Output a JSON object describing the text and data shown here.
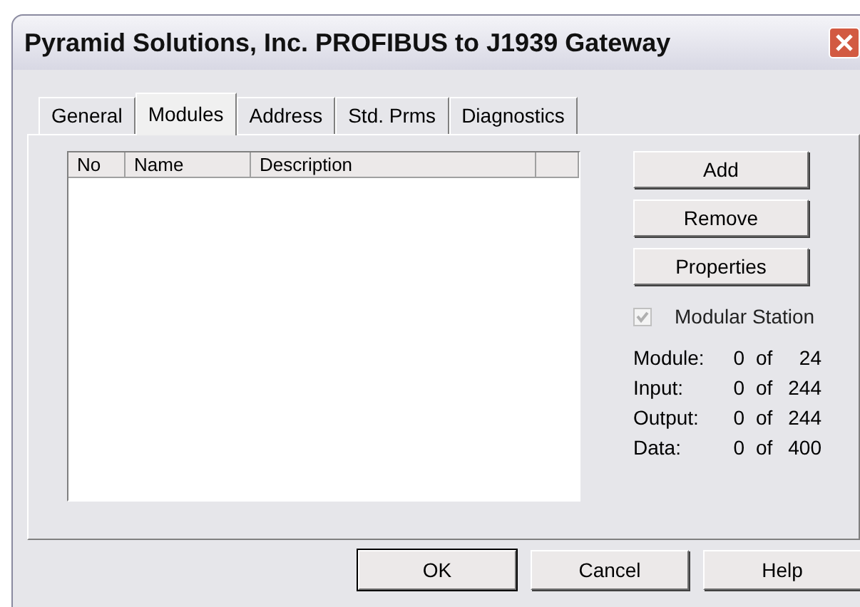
{
  "window": {
    "title": "Pyramid Solutions, Inc. PROFIBUS to J1939 Gateway"
  },
  "tabs": [
    {
      "label": "General",
      "selected": false
    },
    {
      "label": "Modules",
      "selected": true
    },
    {
      "label": "Address",
      "selected": false
    },
    {
      "label": "Std. Prms",
      "selected": false
    },
    {
      "label": "Diagnostics",
      "selected": false
    }
  ],
  "table": {
    "columns": [
      "No",
      "Name",
      "Description"
    ]
  },
  "side_buttons": [
    "Add",
    "Remove",
    "Properties"
  ],
  "modular_station": {
    "label": "Modular Station",
    "checked": true,
    "disabled": true
  },
  "stats": [
    {
      "label": "Module:",
      "value": "0",
      "of": "of",
      "max": "24"
    },
    {
      "label": "Input:",
      "value": "0",
      "of": "of",
      "max": "244"
    },
    {
      "label": "Output:",
      "value": "0",
      "of": "of",
      "max": "244"
    },
    {
      "label": "Data:",
      "value": "0",
      "of": "of",
      "max": "400"
    }
  ],
  "buttons": [
    {
      "label": "OK",
      "default": true
    },
    {
      "label": "Cancel",
      "default": false
    },
    {
      "label": "Help",
      "default": false
    }
  ]
}
